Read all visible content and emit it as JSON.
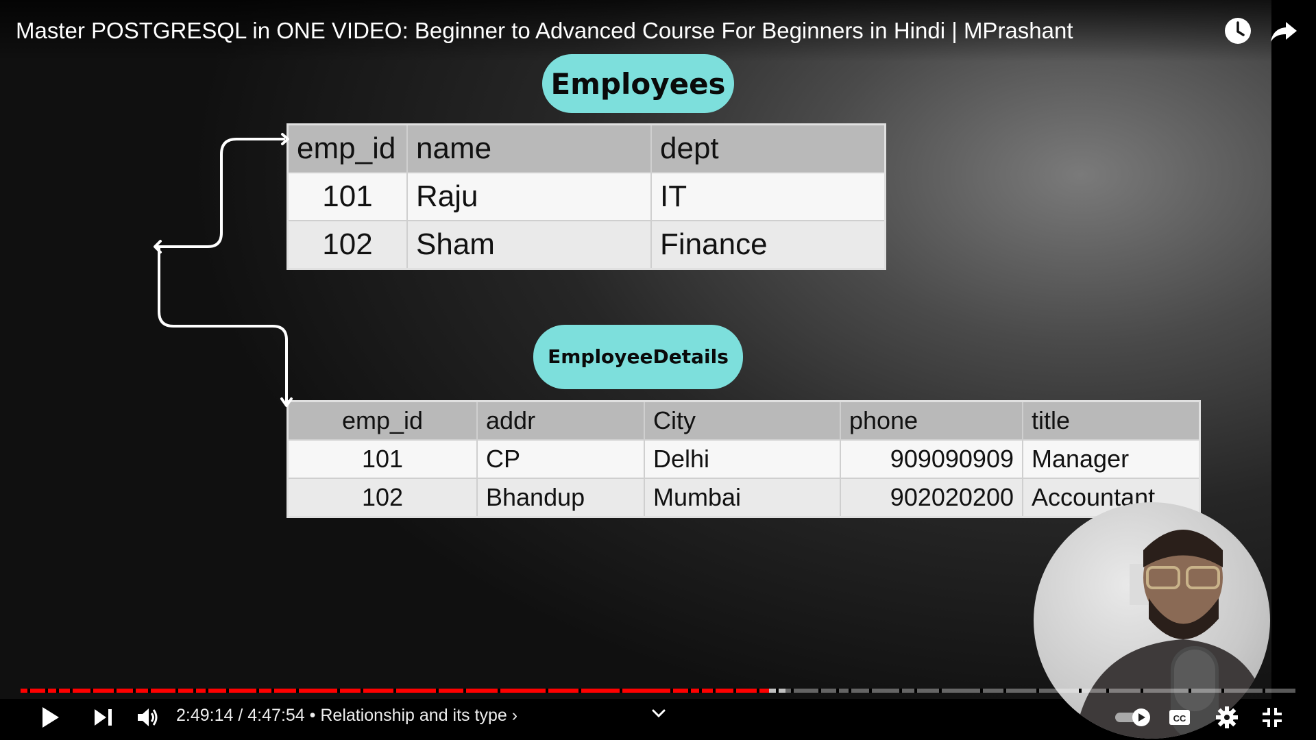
{
  "video": {
    "title": "Master POSTGRESQL in ONE VIDEO: Beginner to Advanced Course For Beginners in Hindi | MPrashant"
  },
  "slide": {
    "employees_label": "Employees",
    "details_label_line1": "Employee",
    "details_label_line2": "Details",
    "pill_color": "#7ddfdc",
    "employees_table": {
      "columns": [
        "emp_id",
        "name",
        "dept"
      ],
      "rows": [
        [
          "101",
          "Raju",
          "IT"
        ],
        [
          "102",
          "Sham",
          "Finance"
        ]
      ]
    },
    "details_table": {
      "columns": [
        "emp_id",
        "addr",
        "City",
        "phone",
        "title"
      ],
      "rows": [
        [
          "101",
          "CP",
          "Delhi",
          "909090909",
          "Manager"
        ],
        [
          "102",
          "Bhandup",
          "Mumbai",
          "902020200",
          "Accountant"
        ]
      ]
    }
  },
  "player": {
    "current_time": "2:49:14",
    "duration": "4:47:54",
    "chapter": "Relationship and its type",
    "progress_fraction": 0.587,
    "buffered_fraction": 0.6,
    "accent_color": "#ff0000",
    "icons": [
      "watch-later-icon",
      "share-icon",
      "play-icon",
      "next-icon",
      "volume-icon",
      "chevron-right-icon",
      "chevron-down-icon",
      "autoplay-toggle-icon",
      "captions-icon",
      "settings-icon",
      "exit-fullscreen-icon"
    ]
  }
}
